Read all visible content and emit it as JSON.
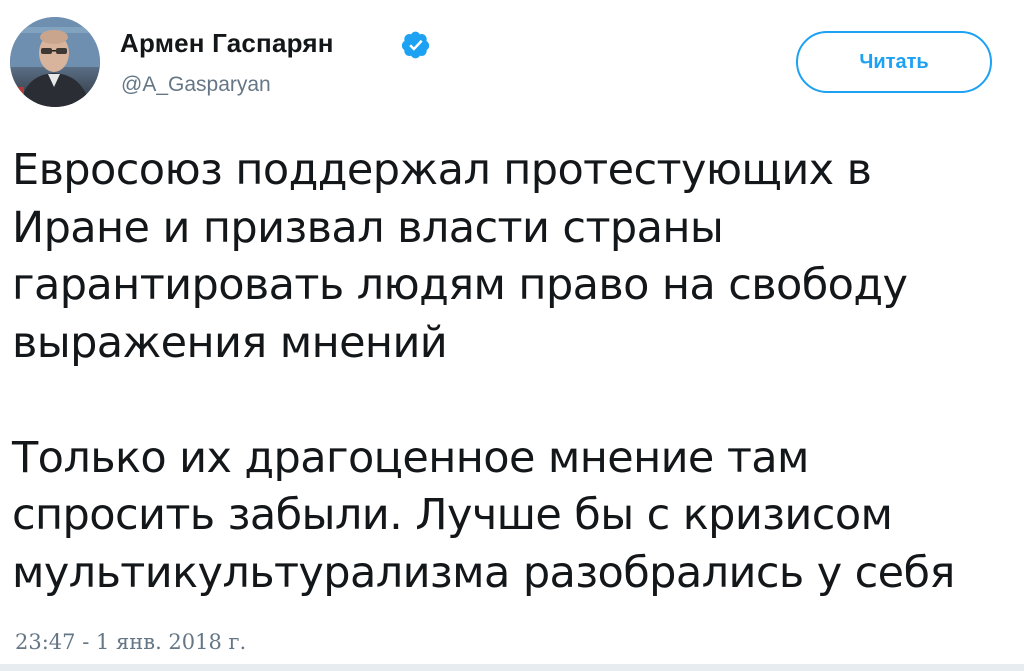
{
  "author": {
    "name": "Армен Гаспарян",
    "handle": "@A_Gasparyan",
    "verified": true,
    "avatar_icon": "avatar-photo"
  },
  "follow_button": {
    "label": "Читать"
  },
  "tweet": {
    "paragraphs": [
      [
        "Евросоюз поддержал протестующих в",
        "Иране и призвал власти страны",
        "гарантировать людям право на свободу",
        "выражения мнений"
      ],
      [
        "Только их драгоценное мнение там",
        "спросить забыли. Лучше бы с кризисом",
        "мультикультурализма разобрались у себя"
      ]
    ],
    "timestamp": "23:47 - 1 янв. 2018 г."
  },
  "colors": {
    "accent": "#1da1f2",
    "text": "#14171a",
    "secondary": "#657786"
  }
}
